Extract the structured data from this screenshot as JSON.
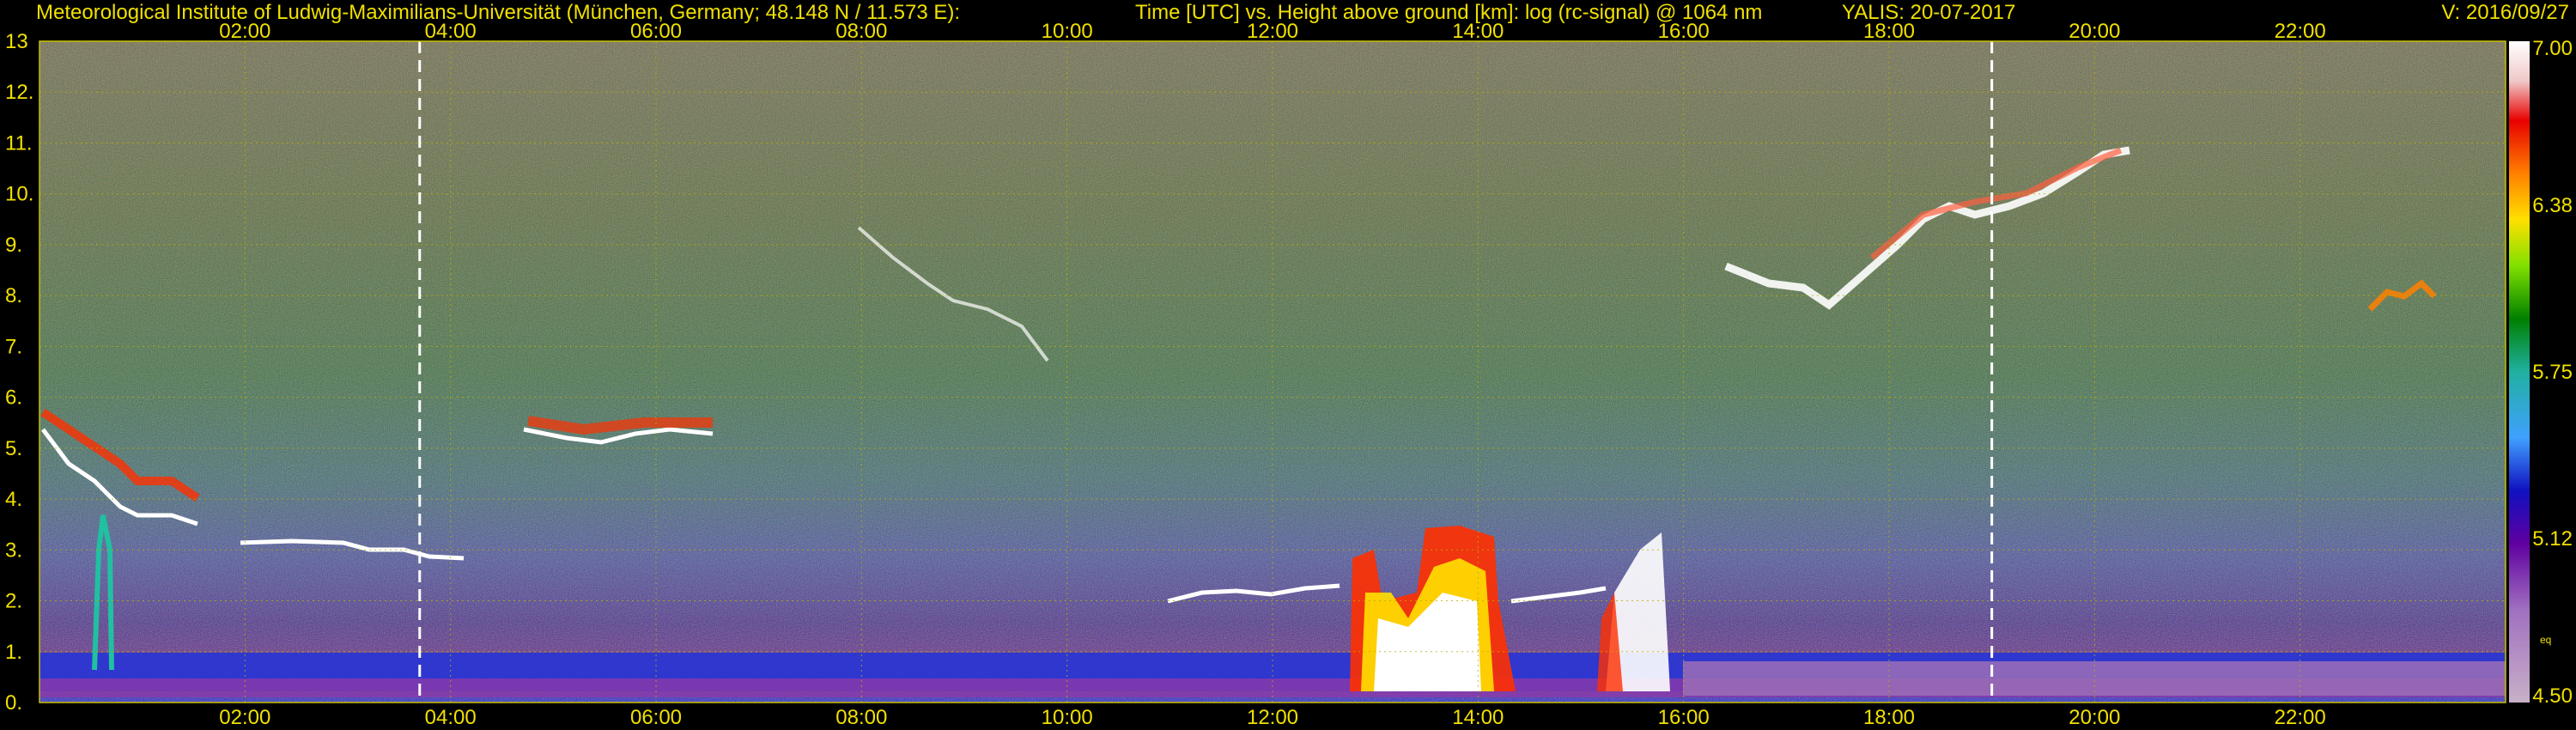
{
  "header": {
    "institute": "Meteorological Institute of Ludwig-Maximilians-Universität (München, Germany; 48.148 N / 11.573 E):",
    "description": "Time [UTC] vs. Height above ground [km]: log (rc-signal) @ 1064 nm",
    "instrument": "YALIS: 20-07-2017",
    "version": "V: 2016/09/27"
  },
  "colors": {
    "background": "#000000",
    "header_text": "#f0e000",
    "axis_text": "#f0e000",
    "grid": "#b8b000"
  },
  "chart_data": {
    "type": "heatmap",
    "title": "Time [UTC] vs. Height above ground [km]: log (rc-signal) @ 1064 nm",
    "x_range_hours": [
      0,
      24
    ],
    "x_ticks": [
      "02:00",
      "04:00",
      "06:00",
      "08:00",
      "10:00",
      "12:00",
      "14:00",
      "16:00",
      "18:00",
      "20:00",
      "22:00"
    ],
    "x_tick_hours": [
      2,
      4,
      6,
      8,
      10,
      12,
      14,
      16,
      18,
      20,
      22
    ],
    "y_range_km": [
      0,
      13
    ],
    "y_ticks": [
      "0.",
      "1.",
      "2.",
      "3.",
      "4.",
      "5.",
      "6.",
      "7.",
      "8.",
      "9.",
      "10.",
      "11.",
      "12.",
      "13"
    ],
    "y_tick_values": [
      0,
      1,
      2,
      3,
      4,
      5,
      6,
      7,
      8,
      9,
      10,
      11,
      12,
      13
    ],
    "dashed_markers_hours": [
      3.7,
      19.0
    ],
    "colorbar": {
      "labels": [
        "7.00",
        "6.38",
        "5.75",
        "5.12",
        "eq",
        "4.50"
      ],
      "values": [
        7.0,
        6.38,
        5.75,
        5.12,
        4.75,
        4.5
      ],
      "range": [
        4.5,
        7.0
      ]
    },
    "grid": true
  }
}
